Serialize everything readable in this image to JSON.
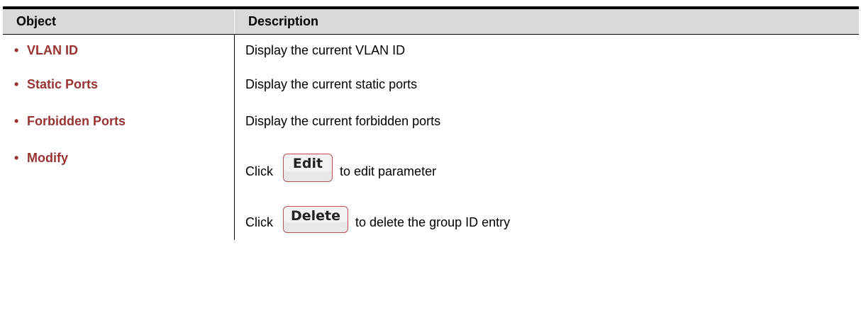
{
  "table": {
    "headers": {
      "object": "Object",
      "description": "Description"
    },
    "bullet": "•",
    "rows": [
      {
        "object": "VLAN ID",
        "description": "Display the current VLAN ID"
      },
      {
        "object": "Static Ports",
        "description": "Display the current static ports"
      },
      {
        "object": "Forbidden Ports",
        "description": "Display the current forbidden ports"
      },
      {
        "object": "Modify"
      }
    ],
    "modify": {
      "click": "Click",
      "edit_button": "Edit",
      "edit_text": "to edit parameter",
      "delete_button": "Delete",
      "delete_text": "to delete the group ID entry"
    }
  },
  "colors": {
    "header_bg": "#d9d9d9",
    "object_text": "#993333",
    "button_border": "#c0504d"
  }
}
